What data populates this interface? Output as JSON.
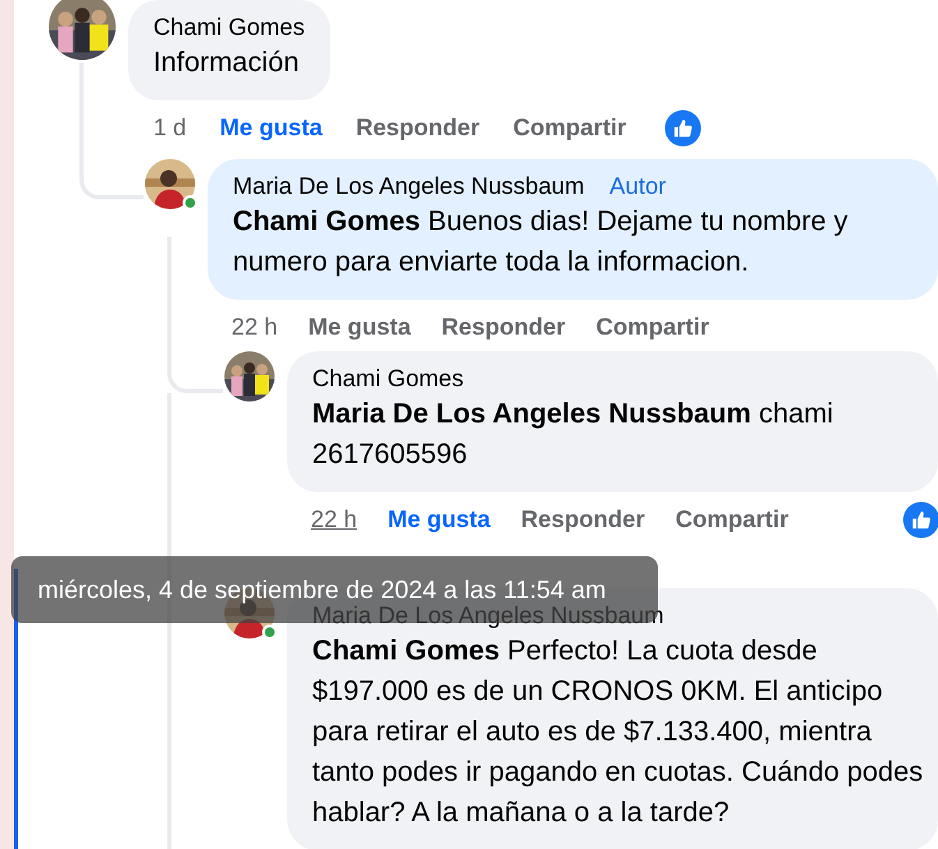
{
  "comments": [
    {
      "author": "Chami Gomes",
      "text": "Información",
      "highlighted": false,
      "online": false,
      "time": "1 d",
      "time_underlined": false,
      "actions": [
        {
          "label": "Me gusta",
          "selected": true
        },
        {
          "label": "Responder",
          "selected": false
        },
        {
          "label": "Compartir",
          "selected": false
        }
      ],
      "reaction": true,
      "children": [
        {
          "author": "Maria De Los Angeles Nussbaum",
          "badge": "Autor",
          "mention": "Chami Gomes",
          "text": "Buenos dias! Dejame tu nombre y numero para enviarte toda la informacion.",
          "highlighted": true,
          "online": true,
          "time": "22 h",
          "time_underlined": false,
          "actions": [
            {
              "label": "Me gusta",
              "selected": false
            },
            {
              "label": "Responder",
              "selected": false
            },
            {
              "label": "Compartir",
              "selected": false
            }
          ],
          "reaction": false,
          "children": [
            {
              "author": "Chami Gomes",
              "mention": "Maria De Los Angeles Nussbaum",
              "text": "chami 2617605596",
              "highlighted": false,
              "online": false,
              "time": "22 h",
              "time_underlined": true,
              "actions": [
                {
                  "label": "Me gusta",
                  "selected": true
                },
                {
                  "label": "Responder",
                  "selected": false
                },
                {
                  "label": "Compartir",
                  "selected": false
                }
              ],
              "reaction": true
            },
            {
              "author": "Maria De Los Angeles Nussbaum",
              "mention": "Chami Gomes",
              "text": "Perfecto! La cuota desde $197.000 es de un CRONOS 0KM. El anticipo para retirar el auto es de $7.133.400, mientra tanto podes ir pagando en cuotas. Cuándo podes hablar? A la mañana o a la tarde?",
              "highlighted": false,
              "online": true
            }
          ]
        }
      ]
    }
  ],
  "tooltip": "miércoles, 4 de septiembre de 2024 a las 11:54 am"
}
